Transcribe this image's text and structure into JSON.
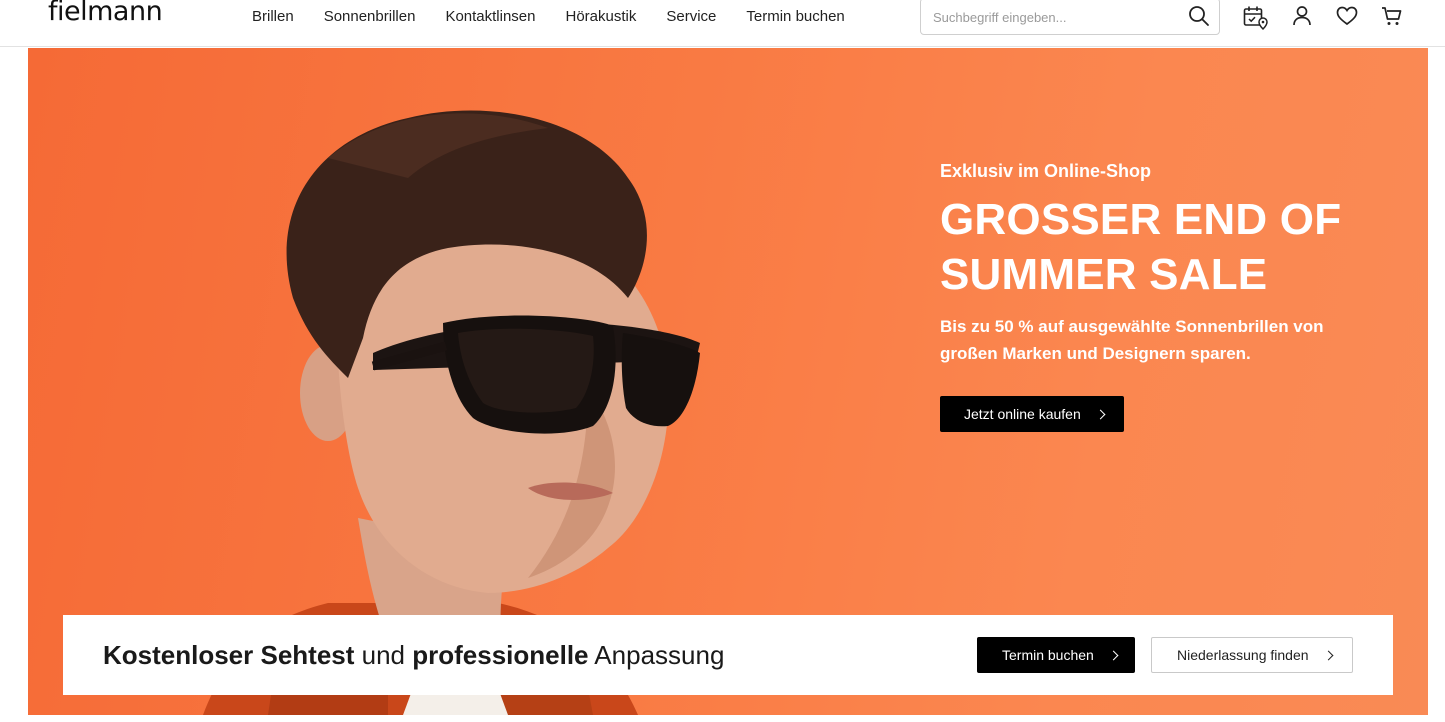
{
  "header": {
    "logo": "fielmann",
    "nav": [
      "Brillen",
      "Sonnenbrillen",
      "Kontaktlinsen",
      "Hörakustik",
      "Service",
      "Termin buchen"
    ],
    "search": {
      "placeholder": "Suchbegriff eingeben..."
    },
    "icons": [
      "search-icon",
      "appointment-calendar-icon",
      "account-icon",
      "wishlist-heart-icon",
      "cart-icon"
    ]
  },
  "hero": {
    "eyebrow": "Exklusiv im Online-Shop",
    "headline_line1": "GROSSER END OF",
    "headline_line2": "SUMMER SALE",
    "subline_line1": "Bis zu 50 % auf ausgewählte Sonnenbrillen von",
    "subline_line2": "großen Marken und Designern sparen.",
    "cta": "Jetzt online kaufen",
    "background_color": "#f97a43"
  },
  "banner": {
    "part1": "Kostenloser Sehtest",
    "part2": " und ",
    "part3": "professionelle",
    "part4": " Anpassung",
    "primary_button": "Termin buchen",
    "secondary_button": "Niederlassung finden"
  }
}
